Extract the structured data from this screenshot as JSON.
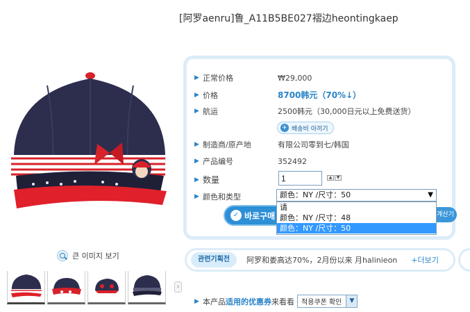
{
  "product": {
    "title": "[阿罗aenru]鲁_A11B5BE027褶边heontingkaep"
  },
  "gallery": {
    "zoom_label": "큰 이미지 보기",
    "thumb_count": 4,
    "next_icon": "›"
  },
  "info": {
    "rows": [
      {
        "label": "正常价格",
        "value": "₩29,000"
      },
      {
        "label": "价格",
        "value": "8700韩元（70%↓）"
      },
      {
        "label": "航运",
        "value": "2500韩元（30,000日元以上免费送货）"
      },
      {
        "label": "制造商/原产地",
        "value": "有限公司零到七/韩国"
      },
      {
        "label": "产品编号",
        "value": "352492"
      },
      {
        "label": "数量",
        "value": ""
      },
      {
        "label": "颜色和类型",
        "value": ""
      }
    ],
    "shipping_badge": "배송비 아끼기",
    "quantity_value": "1",
    "stepper_up": "▲",
    "stepper_down": "▼",
    "select_value": "颜色：NY /尺寸：50",
    "select_caret": "▼",
    "options": [
      {
        "label": "请",
        "selected": false
      },
      {
        "label": "颜色：NY /尺寸：48",
        "selected": false
      },
      {
        "label": "颜色：NY /尺寸：50",
        "selected": true
      }
    ],
    "buy_label": "바로구매",
    "calc_label": "계산기"
  },
  "promo": {
    "tag": "관련기획전",
    "text": "阿罗和娄高达70%，2月份以来 月halinieon",
    "more": "+더보기"
  },
  "coupon": {
    "prefix": "本产品",
    "highlight": "适用的优惠券",
    "suffix": "来看看",
    "select_label": "적용쿠폰 확인",
    "caret": "▼"
  },
  "colors": {
    "accent": "#2a84c8",
    "box_border": "#dcecf8",
    "cap_navy": "#2d2e4d",
    "cap_red": "#d8222a"
  }
}
